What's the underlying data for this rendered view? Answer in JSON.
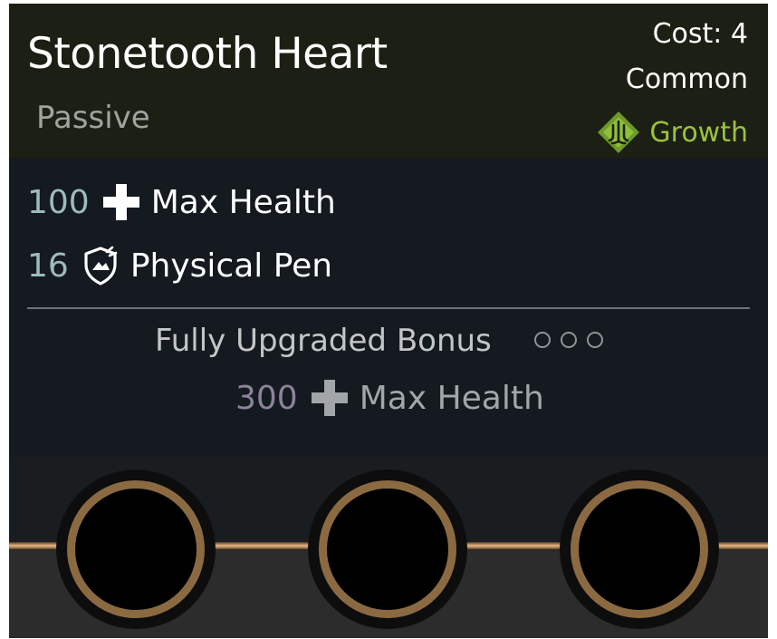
{
  "item": {
    "name": "Stonetooth Heart",
    "type": "Passive",
    "cost": "Cost: 4",
    "rarity": "Common",
    "school": "Growth",
    "school_icon": "growth-emblem-icon",
    "school_color": "#9ac33a"
  },
  "stats": [
    {
      "value": "100",
      "icon": "plus-icon",
      "label": "Max Health"
    },
    {
      "value": "16",
      "icon": "physical-pen-icon",
      "label": "Physical Pen"
    }
  ],
  "bonus": {
    "title": "Fully Upgraded Bonus",
    "upgrade_level": 0,
    "upgrade_max": 3,
    "value": "300",
    "icon": "plus-icon",
    "label": "Max Health"
  },
  "slots": [
    {
      "name": "upgrade-slot-1"
    },
    {
      "name": "upgrade-slot-2"
    },
    {
      "name": "upgrade-slot-3"
    }
  ]
}
